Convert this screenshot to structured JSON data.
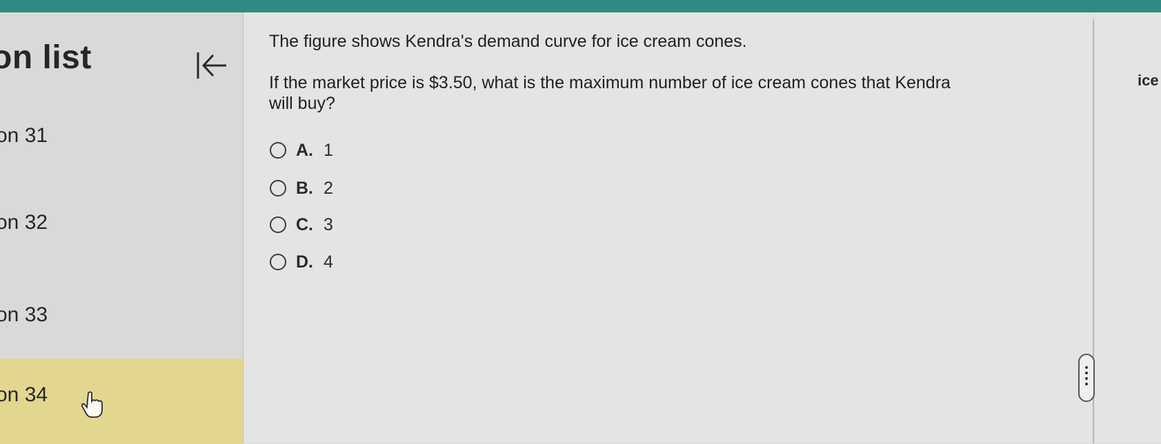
{
  "sidebar": {
    "title": "on list",
    "items": [
      {
        "label": "on 31"
      },
      {
        "label": "on 32"
      },
      {
        "label": "on 33"
      },
      {
        "label": "on 34"
      }
    ]
  },
  "question": {
    "line1": "The figure shows Kendra's demand curve for ice cream cones.",
    "line2": "If the market price is $3.50, what is the maximum number of ice cream cones that Kendra",
    "line3": "will buy?"
  },
  "options": [
    {
      "letter": "A.",
      "text": "1"
    },
    {
      "letter": "B.",
      "text": "2"
    },
    {
      "letter": "C.",
      "text": "3"
    },
    {
      "letter": "D.",
      "text": "4"
    }
  ],
  "right_panel": {
    "label": "ice"
  },
  "colors": {
    "topbar": "#2f8a83",
    "active_item": "#e3d78f"
  }
}
